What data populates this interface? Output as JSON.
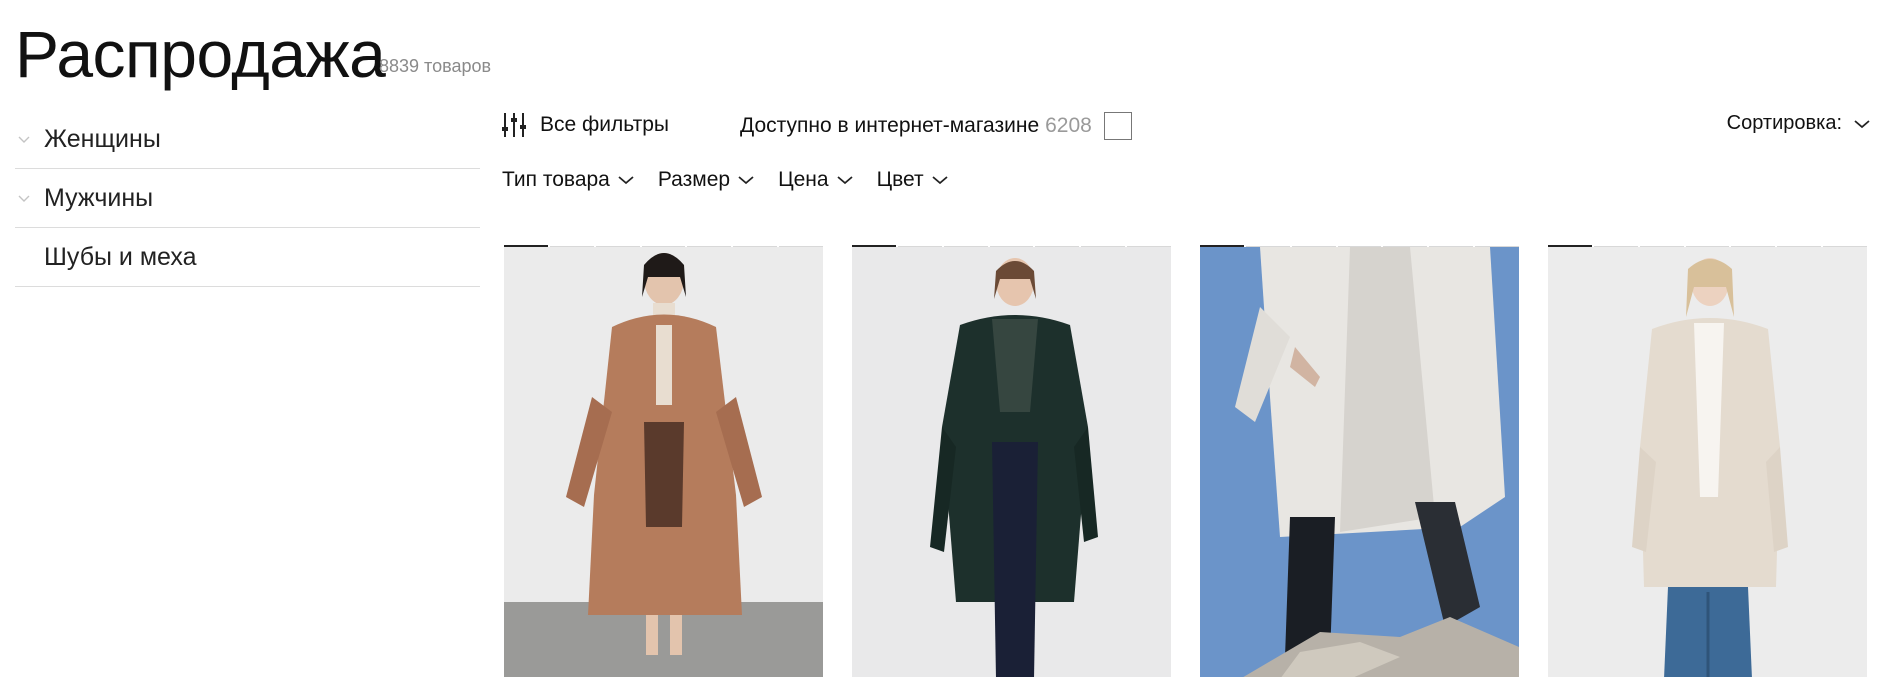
{
  "page": {
    "title": "Распродажа",
    "count": "8839 товаров"
  },
  "sidebar": {
    "items": [
      {
        "label": "Женщины",
        "has_chevron": true
      },
      {
        "label": "Мужчины",
        "has_chevron": true
      },
      {
        "label": "Шубы и меха",
        "has_chevron": false
      }
    ]
  },
  "toolbar": {
    "all_filters": "Все фильтры",
    "available_label": "Доступно в интернет-магазине",
    "available_count": "6208",
    "available_checked": false,
    "sort_label": "Сортировка:"
  },
  "filters": [
    {
      "label": "Тип товара"
    },
    {
      "label": "Размер"
    },
    {
      "label": "Цена"
    },
    {
      "label": "Цвет"
    }
  ],
  "products": [
    {
      "image": "model-in-camel-fur-coat",
      "slides": 7,
      "active_slide": 1
    },
    {
      "image": "model-in-dark-green-fur-coat",
      "slides": 7,
      "active_slide": 1
    },
    {
      "image": "model-in-white-shearling-coat-walking-on-rocks",
      "slides": 7,
      "active_slide": 1
    },
    {
      "image": "model-in-cream-shearling-coat",
      "slides": 7,
      "active_slide": 1
    }
  ],
  "colors": {
    "text": "#111111",
    "muted": "#8a8a8a",
    "divider": "#dcdcdc"
  }
}
